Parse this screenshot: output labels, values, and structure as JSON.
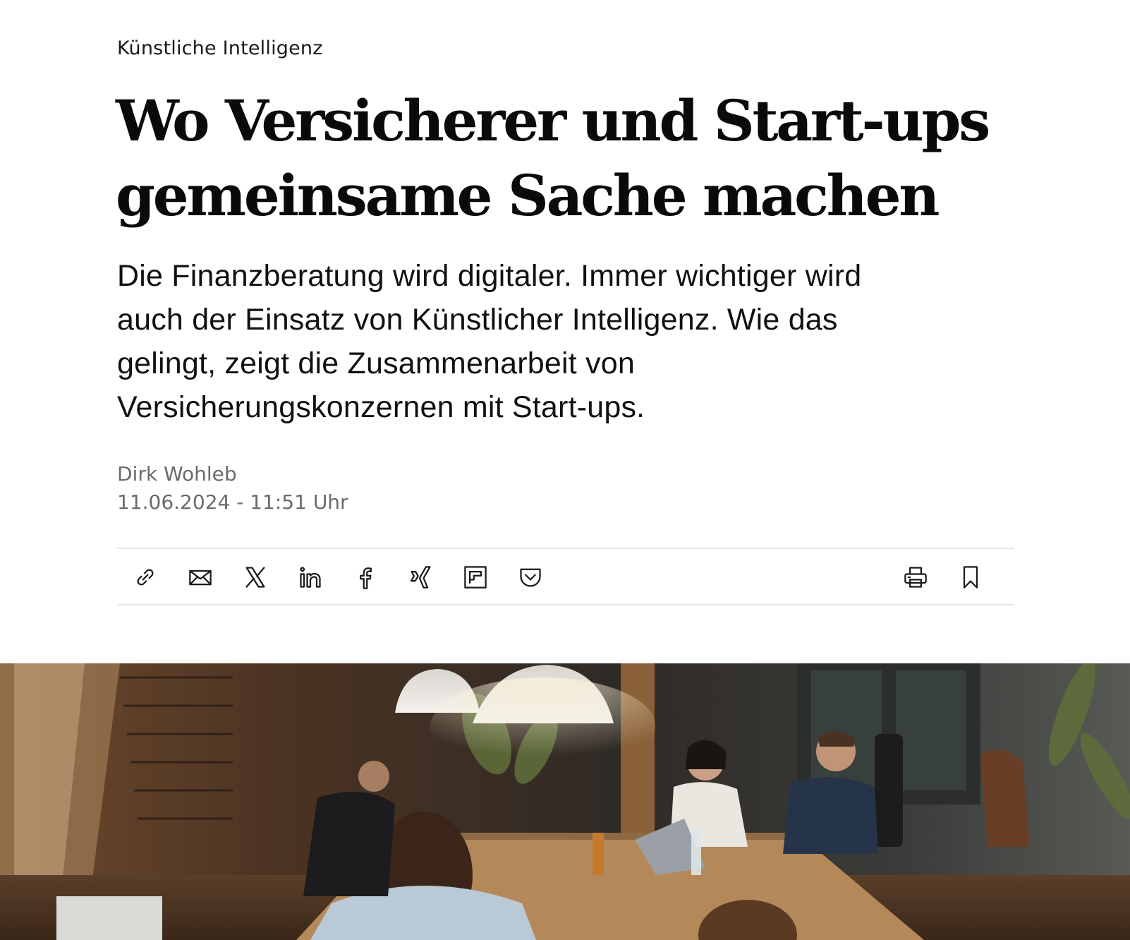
{
  "article": {
    "kicker": "Künstliche Intelligenz",
    "headline_line1": "Wo Versicherer und Start-ups",
    "headline_line2": "gemeinsame Sache machen",
    "lead_line1": "Die Finanzberatung wird digitaler. Immer wichtiger wird",
    "lead_line2": "auch der Einsatz von Künstlicher Intelligenz. Wie das",
    "lead_line3": "gelingt, zeigt die Zusammenarbeit von",
    "lead_line4": "Versicherungskonzernen mit Start-ups.",
    "author": "Dirk Wohleb",
    "date": "11.06.2024 - 11:51 Uhr"
  },
  "share_bar": {
    "buttons": [
      {
        "name": "link-icon"
      },
      {
        "name": "mail-icon"
      },
      {
        "name": "x-twitter-icon"
      },
      {
        "name": "linkedin-icon"
      },
      {
        "name": "facebook-icon"
      },
      {
        "name": "xing-icon"
      },
      {
        "name": "flipboard-icon"
      },
      {
        "name": "pocket-icon"
      }
    ],
    "actions": [
      {
        "name": "print-icon"
      },
      {
        "name": "bookmark-icon"
      }
    ]
  },
  "hero": {
    "description_icon": "photo"
  },
  "colors": {
    "text": "#111111",
    "meta": "#6b6b6b",
    "divider": "#e6e6e6"
  }
}
